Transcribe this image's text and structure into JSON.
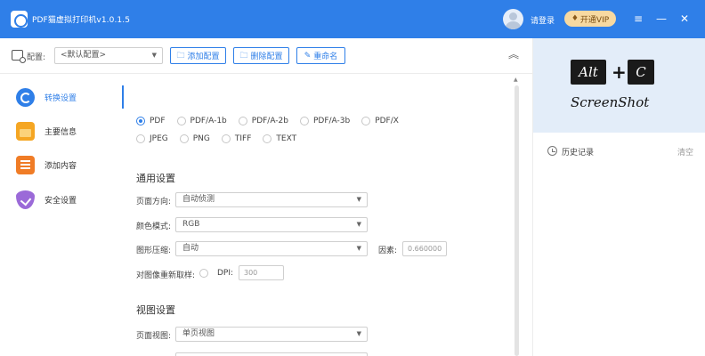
{
  "app": {
    "title": "PDF猫虚拟打印机v1.0.1.5",
    "login_label": "请登录",
    "vip_label": "开通VIP",
    "menu_glyph": "≡",
    "minimize_glyph": "—",
    "close_glyph": "✕"
  },
  "toolbar": {
    "config_label": "配置:",
    "config_value": "<默认配置>",
    "add_config": "添加配置",
    "delete_config": "删除配置",
    "rename": "重命名"
  },
  "sidebar": {
    "items": [
      {
        "label": "转换设置",
        "icon": "convert-icon",
        "active": true
      },
      {
        "label": "主要信息",
        "icon": "folder-icon",
        "active": false
      },
      {
        "label": "添加内容",
        "icon": "document-icon",
        "active": false
      },
      {
        "label": "安全设置",
        "icon": "shield-icon",
        "active": false
      }
    ]
  },
  "formats": {
    "row1": [
      "PDF",
      "PDF/A-1b",
      "PDF/A-2b",
      "PDF/A-3b",
      "PDF/X"
    ],
    "row2": [
      "JPEG",
      "PNG",
      "TIFF",
      "TEXT"
    ],
    "selected": "PDF"
  },
  "general": {
    "title": "通用设置",
    "orientation_label": "页面方向:",
    "orientation_value": "自动侦测",
    "color_label": "颜色模式:",
    "color_value": "RGB",
    "compress_label": "图形压缩:",
    "compress_value": "自动",
    "factor_label": "因素:",
    "factor_value": "0.660000",
    "resample_label": "对图像重新取样:",
    "dpi_label": "DPI:",
    "dpi_value": "300"
  },
  "view": {
    "title": "视图设置",
    "page_view_label": "页面视图:",
    "page_view_value": "单页视图"
  },
  "preview": {
    "key1": "Alt",
    "key2": "C",
    "plus": "+",
    "caption": "ScreenShot"
  },
  "history": {
    "label": "历史记录",
    "clear": "清空"
  },
  "colors": {
    "accent": "#2f7fe8",
    "vip": "#f7d9a1",
    "preview_bg": "#e3edf9"
  }
}
